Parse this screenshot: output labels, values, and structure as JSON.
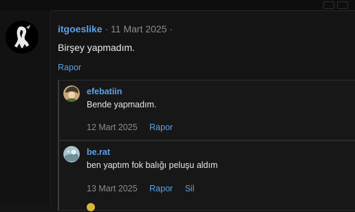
{
  "post": {
    "username": "itgoeslike",
    "separator": "·",
    "date": "11 Mart 2025",
    "trailing": "·",
    "message": "Birşey yapmadım.",
    "report_label": "Rapor"
  },
  "replies": [
    {
      "username": "efebatiin",
      "message": "Bende yapmadım.",
      "date": "12 Mart 2025",
      "actions": [
        "Rapor"
      ],
      "avatar_icon": "anime-character-avatar"
    },
    {
      "username": "be.rat",
      "message": "ben yaptım fok balığı peluşu aldım",
      "date": "13 Mart 2025",
      "actions": [
        "Rapor",
        "Sil"
      ],
      "avatar_icon": "photo-avatar"
    }
  ],
  "colors": {
    "background": "#141414",
    "accent_link": "#5aa3e8",
    "muted_text": "#8c8c8c"
  }
}
